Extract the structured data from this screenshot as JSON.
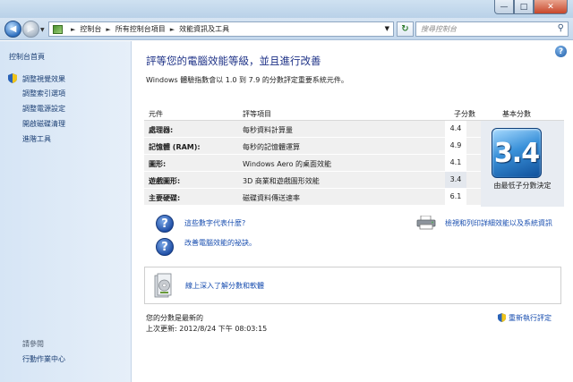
{
  "window": {
    "minimize_glyph": "—",
    "maximize_glyph": "□",
    "close_glyph": "✕"
  },
  "address_bar": {
    "breadcrumbs": [
      "控制台",
      "所有控制台項目",
      "效能資訊及工具"
    ],
    "search_placeholder": "搜尋控制台"
  },
  "sidebar": {
    "home": "控制台首頁",
    "links": [
      "調整視覺效果",
      "調整索引選項",
      "調整電源設定",
      "開啟磁碟清理",
      "進階工具"
    ],
    "see_also_label": "請參閱",
    "see_also_links": [
      "行動作業中心"
    ]
  },
  "main": {
    "title": "評等您的電腦效能等級，並且進行改善",
    "description": "Windows 體驗指數會以 1.0 到 7.9 的分數評定重要系統元件。",
    "table": {
      "headers": [
        "元件",
        "評等項目",
        "子分數",
        "基本分數"
      ],
      "rows": [
        {
          "component": "處理器:",
          "item": "每秒資料計算量",
          "subscore": "4.4"
        },
        {
          "component": "記憶體 (RAM):",
          "item": "每秒的記憶體運算",
          "subscore": "4.9"
        },
        {
          "component": "圖形:",
          "item": "Windows Aero 的桌面效能",
          "subscore": "4.1"
        },
        {
          "component": "遊戲圖形:",
          "item": "3D 商業和遊戲圖形效能",
          "subscore": "3.4"
        },
        {
          "component": "主要硬碟:",
          "item": "磁碟資料傳送速率",
          "subscore": "6.1"
        }
      ],
      "base_score": "3.4",
      "base_caption": "由最低子分數決定"
    },
    "help_links": [
      "這些數字代表什麼?",
      "改善電腦效能的祕訣。"
    ],
    "print_link": "檢視和列印詳細效能以及系統資訊",
    "tip_link": "線上深入了解分數和軟體",
    "status": {
      "line1": "您的分數是最新的",
      "line2": "上次更新: 2012/8/24 下午 08:03:15"
    },
    "rerun_link": "重新執行評定"
  }
}
